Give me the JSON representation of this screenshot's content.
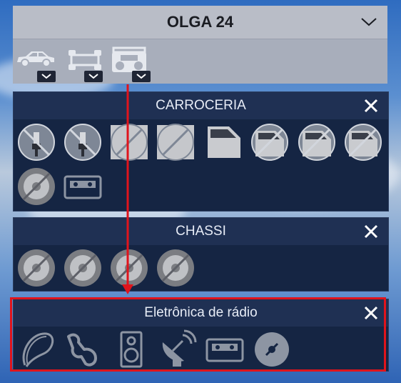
{
  "header": {
    "title": "OLGA 24"
  },
  "categories": [
    {
      "icon": "car-body-icon"
    },
    {
      "icon": "chassis-icon"
    },
    {
      "icon": "radio-icon"
    }
  ],
  "panels": [
    {
      "title": "CARROCERIA",
      "items": [
        "headlight-bulb-icon",
        "headlight-bulb-icon",
        "panel-icon",
        "panel-icon",
        "door-icon",
        "door-icon",
        "door-icon",
        "door-icon",
        "wheel-icon",
        "cassette-icon"
      ]
    },
    {
      "title": "CHASSI",
      "items": [
        "wheel-icon",
        "wheel-icon",
        "wheel-icon",
        "wheel-icon"
      ]
    },
    {
      "title": "Eletrônica de rádio",
      "items": [
        "antenna-cable-icon",
        "connector-icon",
        "speaker-icon",
        "satellite-dish-icon",
        "cassette-icon",
        "cd-disc-icon"
      ]
    }
  ],
  "colors": {
    "highlight": "#e0141c",
    "panel": "#152543"
  }
}
